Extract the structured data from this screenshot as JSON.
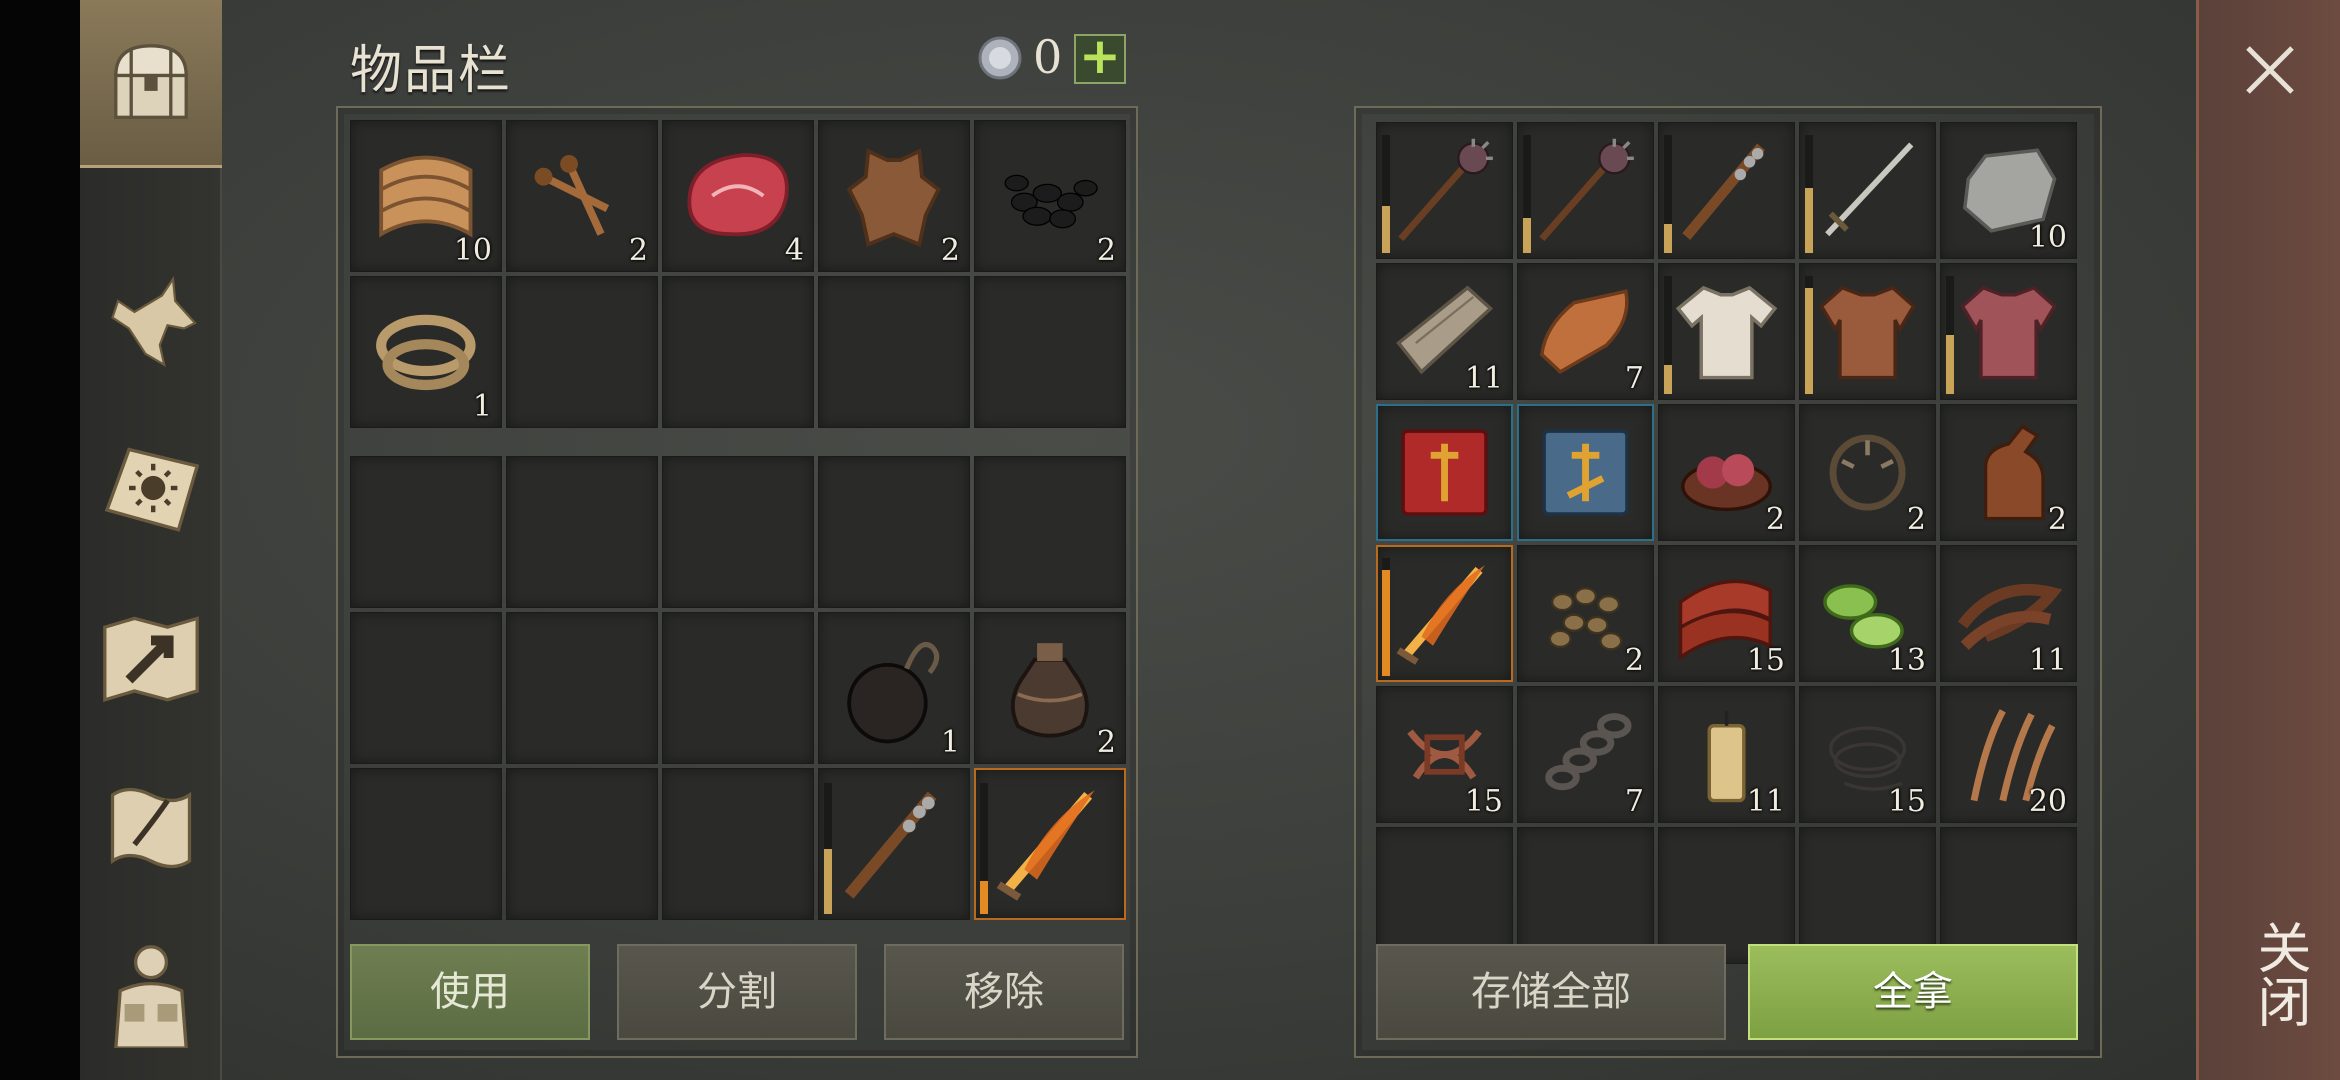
{
  "title": "物品栏",
  "currency": {
    "count": "0",
    "add_label": "+",
    "icon": "coin-icon"
  },
  "nav": [
    {
      "id": "chest",
      "icon": "chest-icon",
      "active": true
    },
    {
      "id": "pet",
      "icon": "wolf-icon"
    },
    {
      "id": "skills",
      "icon": "sun-book-icon"
    },
    {
      "id": "map",
      "icon": "map-icon"
    },
    {
      "id": "quests",
      "icon": "scroll-icon"
    },
    {
      "id": "character",
      "icon": "character-icon"
    }
  ],
  "inventory": {
    "top": [
      {
        "name": "cloth",
        "qty": "10"
      },
      {
        "name": "nails",
        "qty": "2"
      },
      {
        "name": "raw-meat",
        "qty": "4"
      },
      {
        "name": "hide",
        "qty": "2"
      },
      {
        "name": "coal",
        "qty": "2"
      },
      {
        "name": "rope",
        "qty": "1"
      }
    ],
    "bottom": [
      null,
      null,
      null,
      null,
      null,
      null,
      null,
      null,
      {
        "name": "bomb",
        "qty": "1"
      },
      {
        "name": "oil-flask",
        "qty": "2"
      },
      null,
      null,
      null,
      {
        "name": "spiked-club",
        "durability": 0.5
      },
      {
        "name": "flame-sword",
        "durability": 0.25,
        "legend": true
      }
    ]
  },
  "storage": [
    {
      "name": "morningstar",
      "durability": 0.4
    },
    {
      "name": "morningstar",
      "durability": 0.3
    },
    {
      "name": "spiked-club",
      "durability": 0.25
    },
    {
      "name": "sword",
      "durability": 0.55
    },
    {
      "name": "stone",
      "qty": "10"
    },
    {
      "name": "plank",
      "qty": "11"
    },
    {
      "name": "copper-ingot",
      "qty": "7"
    },
    {
      "name": "tunic",
      "durability": 0.25
    },
    {
      "name": "leather-armor",
      "durability": 0.9
    },
    {
      "name": "chain-armor",
      "durability": 0.5
    },
    {
      "name": "red-book",
      "rare": true
    },
    {
      "name": "blue-book",
      "rare": true
    },
    {
      "name": "organs",
      "qty": "2"
    },
    {
      "name": "bear-trap",
      "qty": "2"
    },
    {
      "name": "bottle",
      "qty": "2"
    },
    {
      "name": "flame-sword",
      "durability": 0.9,
      "legend": true
    },
    {
      "name": "seeds",
      "qty": "2"
    },
    {
      "name": "bacon",
      "qty": "15"
    },
    {
      "name": "cucumber-slices",
      "qty": "13"
    },
    {
      "name": "leather-strips",
      "qty": "11"
    },
    {
      "name": "sinew",
      "qty": "15"
    },
    {
      "name": "chain",
      "qty": "7"
    },
    {
      "name": "candle",
      "qty": "11"
    },
    {
      "name": "wire",
      "qty": "15"
    },
    {
      "name": "fiber",
      "qty": "20"
    },
    null,
    null,
    null,
    null,
    null
  ],
  "buttons": {
    "use": "使用",
    "split": "分割",
    "remove": "移除",
    "store_all": "存储全部",
    "take_all": "全拿",
    "close": "关闭"
  },
  "colors": {
    "bright_green": "#9cbd5c",
    "slot_bg": "#2a2a28",
    "rare": "#2b6f8a",
    "legendary": "#b86a1d"
  }
}
